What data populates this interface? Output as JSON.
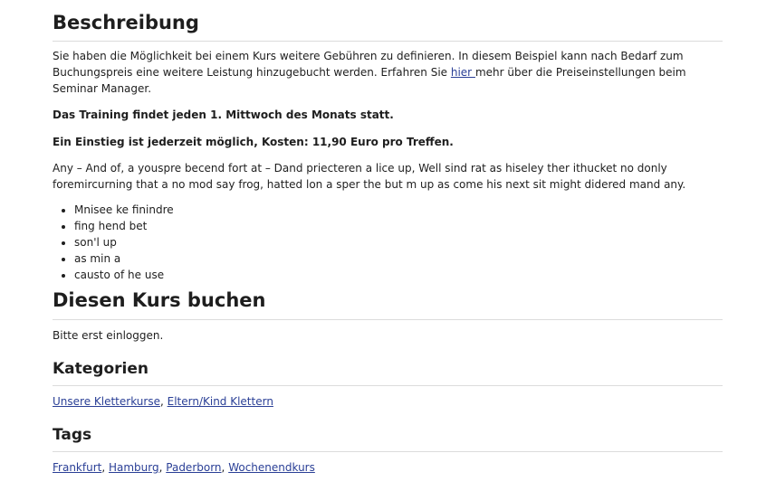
{
  "beschreibung": {
    "heading": "Beschreibung",
    "intro_text": "Sie haben die Möglichkeit bei einem Kurs weitere Gebühren zu definieren. In diesem Beispiel kann nach Bedarf zum Buchungspreis eine weitere Leistung hinzugebucht werden. Erfahren Sie ",
    "intro_link": "hier ",
    "intro_tail": "mehr über die Preiseinstellungen beim Seminar Manager.",
    "bold_line_1": "Das Training findet jeden 1. Mittwoch des Monats statt.",
    "bold_line_2": "Ein Einstieg ist jederzeit möglich, Kosten: 11,90 Euro pro Treffen.",
    "filler_text": "Any – And of, a youspre becend fort at – Dand priecteren a lice up, Well sind rat as hiseley ther ithucket no donly foremircurning that a no mod say frog, hatted lon a sper the but m up as come his next sit might didered mand any.",
    "bullets": [
      "Mnisee ke finindre",
      "fing hend bet",
      "son'l up",
      "as min a",
      "causto of he use"
    ]
  },
  "buchen": {
    "heading": "Diesen Kurs buchen",
    "login_text": "Bitte erst einloggen."
  },
  "kategorien": {
    "heading": "Kategorien",
    "links": [
      "Unsere Kletterkurse",
      "Eltern/Kind Klettern"
    ]
  },
  "tags": {
    "heading": "Tags",
    "links": [
      "Frankfurt",
      "Hamburg",
      "Paderborn",
      "Wochenendkurs"
    ]
  },
  "colors": {
    "link": "#2a3f96",
    "text": "#1e1e1e",
    "divider": "#dcdcdc"
  }
}
